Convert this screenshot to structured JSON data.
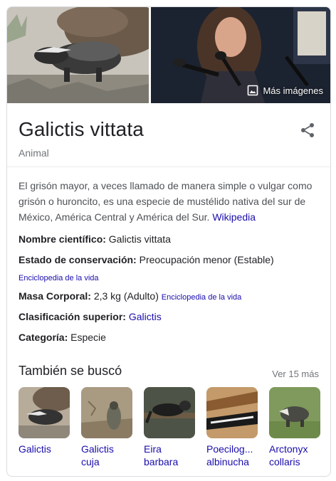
{
  "hero": {
    "more_images_label": "Más imágenes",
    "more_images_icon": "image-icon"
  },
  "header": {
    "title": "Galictis vittata",
    "subtitle": "Animal",
    "share_icon": "share-icon"
  },
  "description": {
    "text": "El grisón mayor, a veces llamado de manera simple o vulgar como grisón o huroncito, es una especie de mustélido nativa del sur de México, América Central y América del Sur.",
    "source_link": "Wikipedia"
  },
  "facts": [
    {
      "label": "Nombre científico:",
      "value": "Galictis vittata"
    },
    {
      "label": "Estado de conservación:",
      "value": "Preocupación menor (Estable)",
      "source_below": "Enciclopedia de la vida"
    },
    {
      "label": "Masa Corporal:",
      "value": "2,3 kg (Adulto)",
      "source_inline": "Enciclopedia de la vida"
    },
    {
      "label": "Clasificación superior:",
      "value_link": "Galictis"
    },
    {
      "label": "Categoría:",
      "value": "Especie"
    }
  ],
  "also_searched": {
    "title": "También se buscó",
    "see_more": "Ver 15 más",
    "items": [
      {
        "line1": "Galictis",
        "line2": ""
      },
      {
        "line1": "Galictis",
        "line2": "cuja"
      },
      {
        "line1": "Eira",
        "line2": "barbara"
      },
      {
        "line1": "Poecilog...",
        "line2": "albinucha"
      },
      {
        "line1": "Arctonyx",
        "line2": "collaris"
      }
    ]
  },
  "colors": {
    "link": "#1a0dab",
    "secondary_text": "#70757a",
    "body_text": "#4d5156",
    "border": "#dadce0"
  }
}
